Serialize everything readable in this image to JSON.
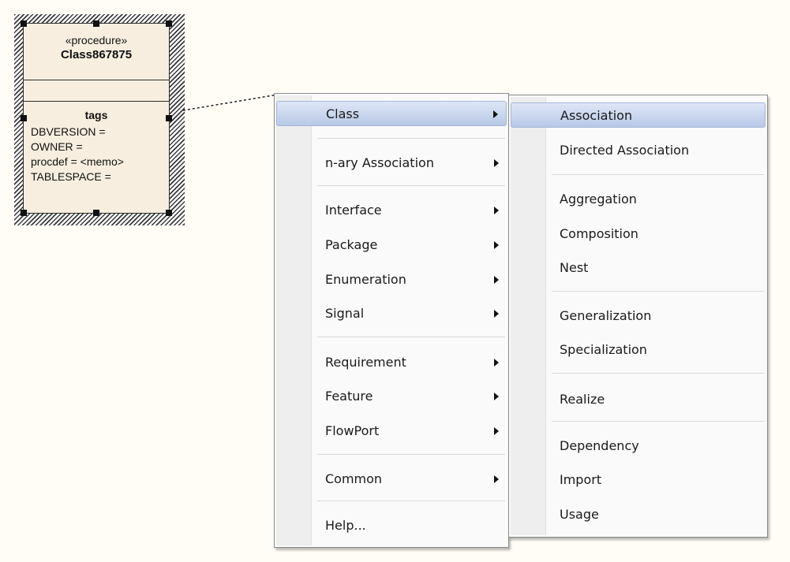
{
  "diagram": {
    "class": {
      "stereotype": "«procedure»",
      "name": "Class867875",
      "tags_title": "tags",
      "tags": [
        "DBVERSION =",
        "OWNER =",
        "procdef = <memo>",
        "TABLESPACE ="
      ]
    }
  },
  "menu1": {
    "items": [
      {
        "label": "Class"
      },
      {
        "label": "n-ary Association"
      },
      {
        "label": "Interface"
      },
      {
        "label": "Package"
      },
      {
        "label": "Enumeration"
      },
      {
        "label": "Signal"
      },
      {
        "label": "Requirement"
      },
      {
        "label": "Feature"
      },
      {
        "label": "FlowPort"
      },
      {
        "label": "Common"
      },
      {
        "label": "Help..."
      }
    ]
  },
  "menu2": {
    "items": [
      {
        "label": "Association"
      },
      {
        "label": "Directed Association"
      },
      {
        "label": "Aggregation"
      },
      {
        "label": "Composition"
      },
      {
        "label": "Nest"
      },
      {
        "label": "Generalization"
      },
      {
        "label": "Specialization"
      },
      {
        "label": "Realize"
      },
      {
        "label": "Dependency"
      },
      {
        "label": "Import"
      },
      {
        "label": "Usage"
      }
    ]
  }
}
